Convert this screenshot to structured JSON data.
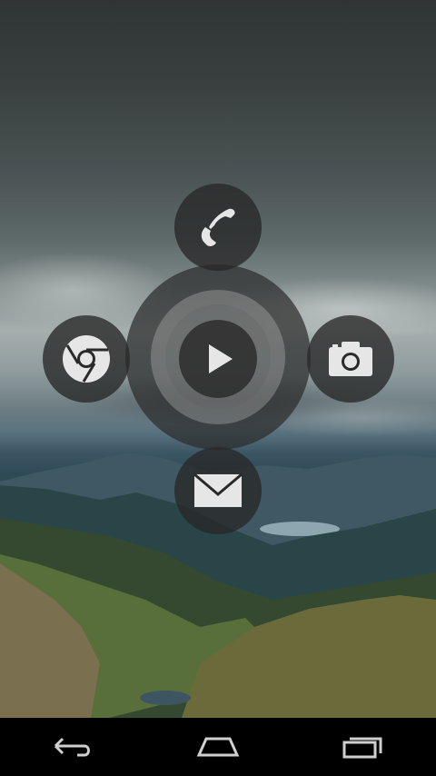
{
  "screen": {
    "wallpaper": "mountain-landscape-stormy-sky"
  },
  "launcher": {
    "center_action": "play-icon",
    "items": [
      {
        "id": "phone",
        "icon": "phone-icon"
      },
      {
        "id": "browser",
        "icon": "chrome-icon"
      },
      {
        "id": "camera",
        "icon": "camera-icon"
      },
      {
        "id": "email",
        "icon": "mail-icon"
      }
    ]
  },
  "navbar": {
    "buttons": [
      {
        "id": "back",
        "icon": "back-icon"
      },
      {
        "id": "home",
        "icon": "home-icon"
      },
      {
        "id": "recents",
        "icon": "recent-apps-icon"
      }
    ]
  },
  "colors": {
    "icon": "#e6e6e6",
    "button_bg": "#282828",
    "navbar_bg": "#000000",
    "nav_icon": "#cfcfcf"
  }
}
